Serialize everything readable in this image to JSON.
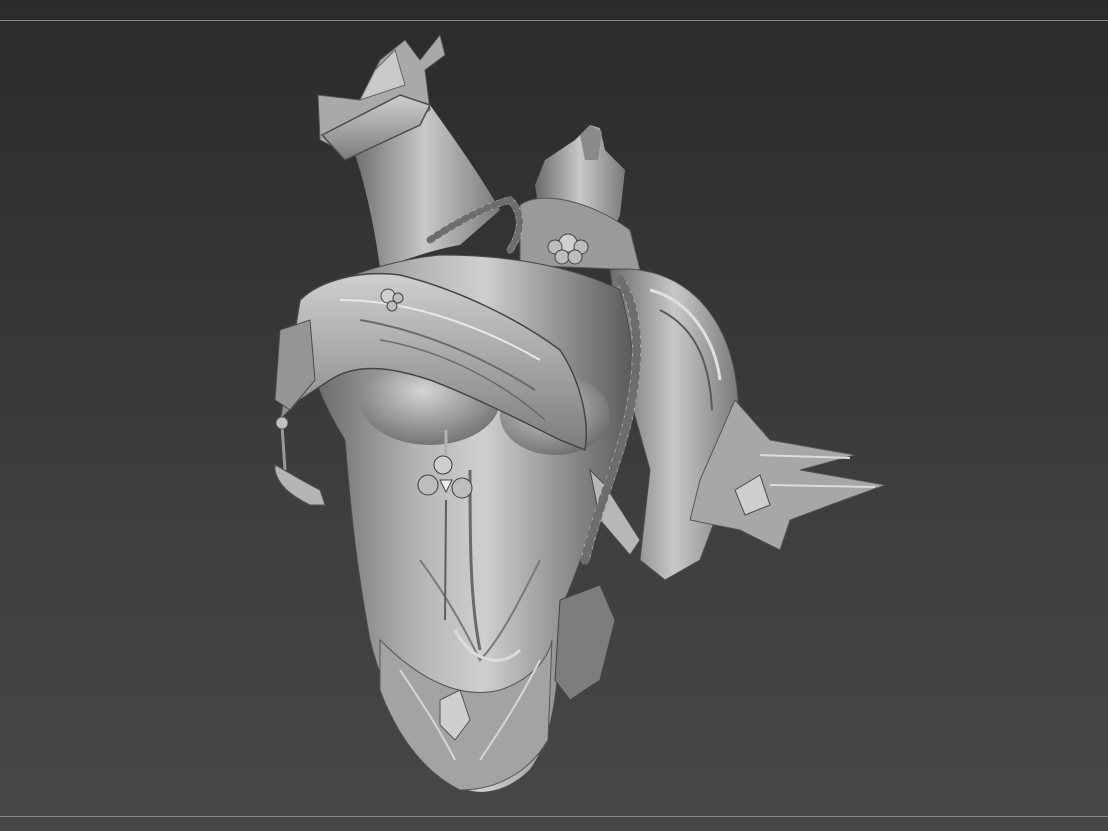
{
  "app": {
    "name": "",
    "viewport": {
      "content": "sculpt-model",
      "material": "matcap-gray",
      "colors": {
        "background_top": "#2b2b2b",
        "background_bottom": "#474747",
        "frame_line": "#8a8a8a",
        "model_base": "#9b9b9b",
        "model_highlight": "#e6e6e6",
        "model_shadow": "#4a4a4a"
      }
    }
  }
}
